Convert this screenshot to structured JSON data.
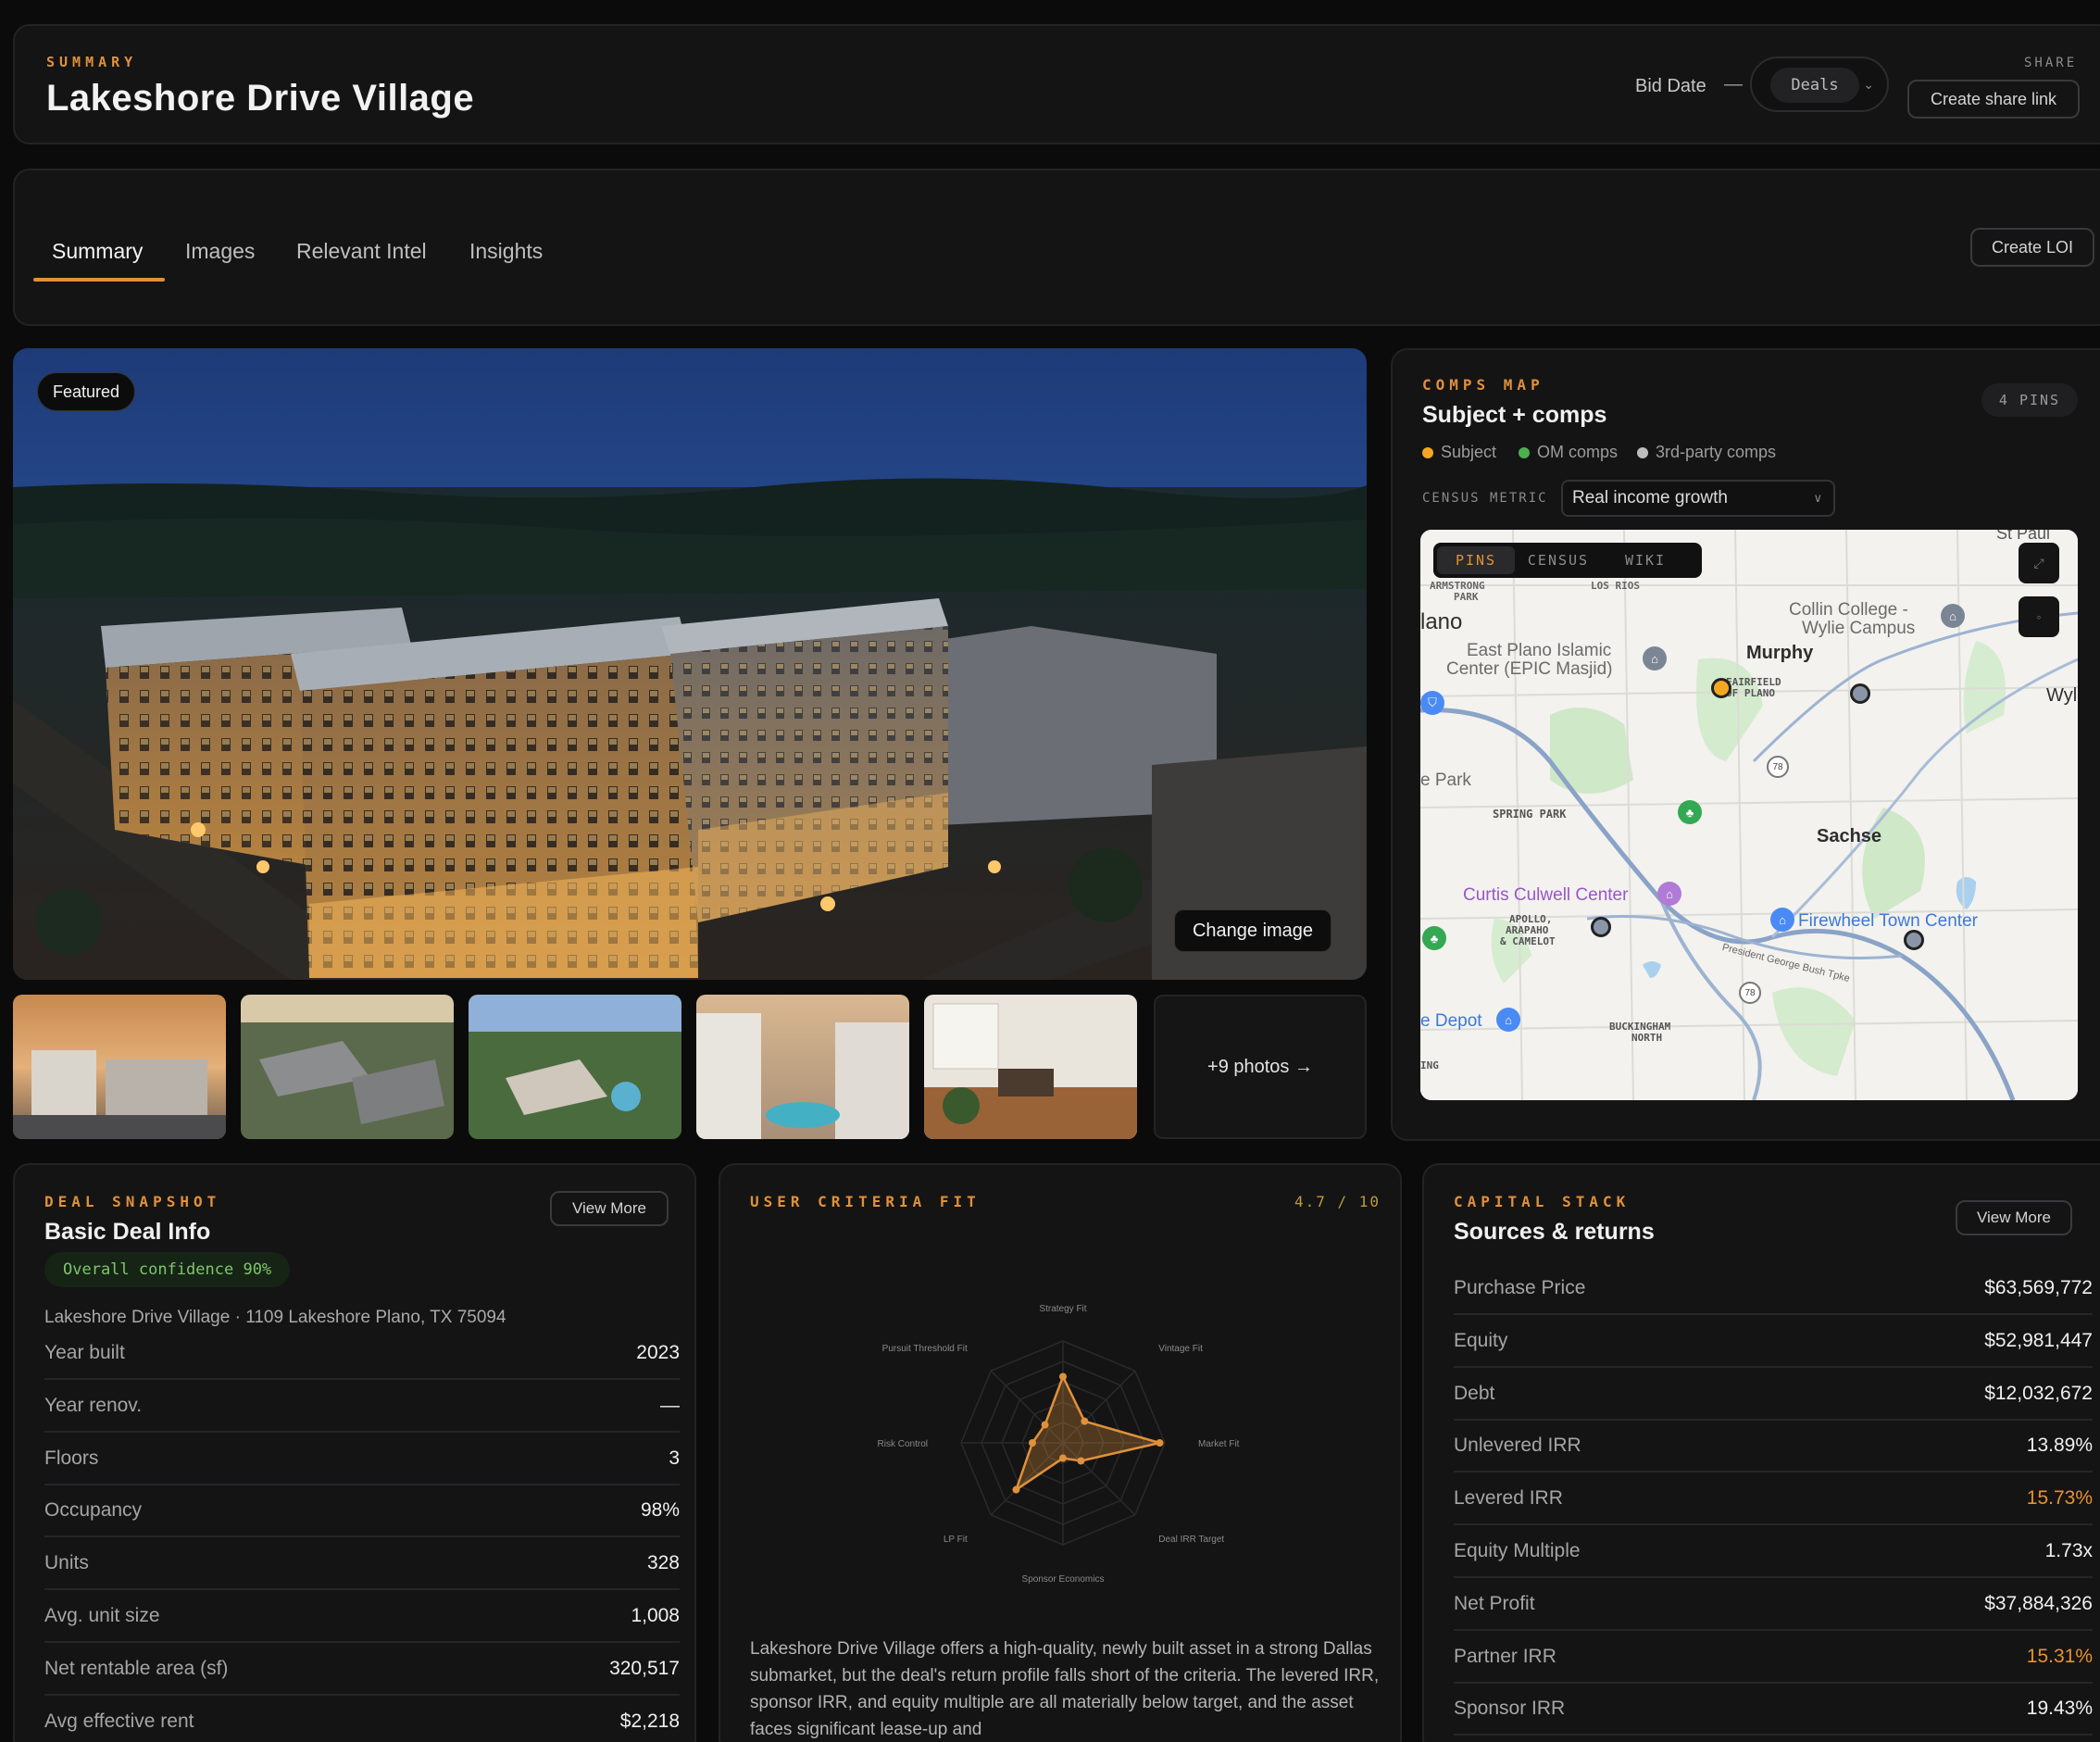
{
  "header": {
    "eyebrow": "SUMMARY",
    "title": "Lakeshore Drive Village",
    "bid_label": "Bid Date",
    "bid_dash": "—",
    "deals_value": "Deals",
    "share_label": "SHARE",
    "share_button": "Create share link"
  },
  "tabs": {
    "items": [
      "Summary",
      "Images",
      "Relevant Intel",
      "Insights"
    ],
    "active": "Summary",
    "create_loi": "Create LOI"
  },
  "hero": {
    "featured": "Featured",
    "change_image": "Change image",
    "more_photos": "+9 photos →"
  },
  "map": {
    "eyebrow": "COMPS MAP",
    "title": "Subject + comps",
    "pins_badge": "4 PINS",
    "legend": [
      {
        "label": "Subject",
        "color": "#f5a623"
      },
      {
        "label": "OM comps",
        "color": "#4caf50"
      },
      {
        "label": "3rd-party comps",
        "color": "#bdbdbd"
      }
    ],
    "census_label": "CENSUS METRIC",
    "census_value": "Real income growth",
    "map_tabs": [
      "PINS",
      "CENSUS",
      "WIKI"
    ],
    "labels": {
      "st_paul": "St Paul",
      "armstrong": "ARMSTRONG",
      "park": "PARK",
      "los_rios": "LOS RIOS",
      "plano": "lano",
      "collin1": "Collin College -",
      "collin2": "Wylie Campus",
      "epic1": "East Plano Islamic",
      "epic2": "Center (EPIC Masjid)",
      "murphy": "Murphy",
      "fairfield1": "FAIRFIELD",
      "fairfield2": "OF PLANO",
      "wy": "Wyl",
      "epark": "e Park",
      "spring_park": "SPRING PARK",
      "sachse": "Sachse",
      "curtis": "Curtis Culwell Center",
      "apollo1": "APOLLO,",
      "apollo2": "ARAPAHO",
      "apollo3": "& CAMELOT",
      "firewheel": "Firewheel Town Center",
      "bush": "President George Bush Tpke",
      "depot": "e Depot",
      "buckingham1": "BUCKINGHAM",
      "buckingham2": "NORTH",
      "ing": "ING",
      "route78": "78"
    }
  },
  "deal": {
    "eyebrow": "DEAL SNAPSHOT",
    "title": "Basic Deal Info",
    "view_more": "View More",
    "confidence": "Overall confidence 90%",
    "address": "Lakeshore Drive Village · 1109 Lakeshore Plano, TX 75094",
    "rows": [
      {
        "k": "Year built",
        "v": "2023"
      },
      {
        "k": "Year renov.",
        "v": "—"
      },
      {
        "k": "Floors",
        "v": "3"
      },
      {
        "k": "Occupancy",
        "v": "98%"
      },
      {
        "k": "Units",
        "v": "328"
      },
      {
        "k": "Avg. unit size",
        "v": "1,008"
      },
      {
        "k": "Net rentable area (sf)",
        "v": "320,517"
      },
      {
        "k": "Avg effective rent",
        "v": "$2,218"
      }
    ]
  },
  "criteria": {
    "eyebrow": "USER CRITERIA FIT",
    "score": "4.7 / 10",
    "axes": [
      "Strategy Fit",
      "Vintage Fit",
      "Market Fit",
      "Deal IRR Target",
      "Sponsor Economics",
      "LP Fit",
      "Risk Control",
      "Pursuit Threshold Fit"
    ],
    "values": [
      6.5,
      3,
      9.5,
      2.5,
      1.5,
      6.5,
      3,
      2.5
    ],
    "max": 10,
    "summary": "Lakeshore Drive Village offers a high-quality, newly built asset in a strong Dallas submarket, but the deal's return profile falls short of the criteria. The levered IRR, sponsor IRR, and equity multiple are all materially below target, and the asset faces significant lease-up and"
  },
  "capital": {
    "eyebrow": "CAPITAL STACK",
    "title": "Sources & returns",
    "view_more": "View More",
    "rows": [
      {
        "k": "Purchase Price",
        "v": "$63,569,772",
        "highlight": false
      },
      {
        "k": "Equity",
        "v": "$52,981,447",
        "highlight": false
      },
      {
        "k": "Debt",
        "v": "$12,032,672",
        "highlight": false
      },
      {
        "k": "Unlevered IRR",
        "v": "13.89%",
        "highlight": false
      },
      {
        "k": "Levered IRR",
        "v": "15.73%",
        "highlight": true
      },
      {
        "k": "Equity Multiple",
        "v": "1.73x",
        "highlight": false
      },
      {
        "k": "Net Profit",
        "v": "$37,884,326",
        "highlight": false
      },
      {
        "k": "Partner IRR",
        "v": "15.31%",
        "highlight": true
      },
      {
        "k": "Sponsor IRR",
        "v": "19.43%",
        "highlight": false
      }
    ]
  },
  "colors": {
    "accent": "#e0913a",
    "card": "#141415",
    "background": "#0b0b0c"
  }
}
